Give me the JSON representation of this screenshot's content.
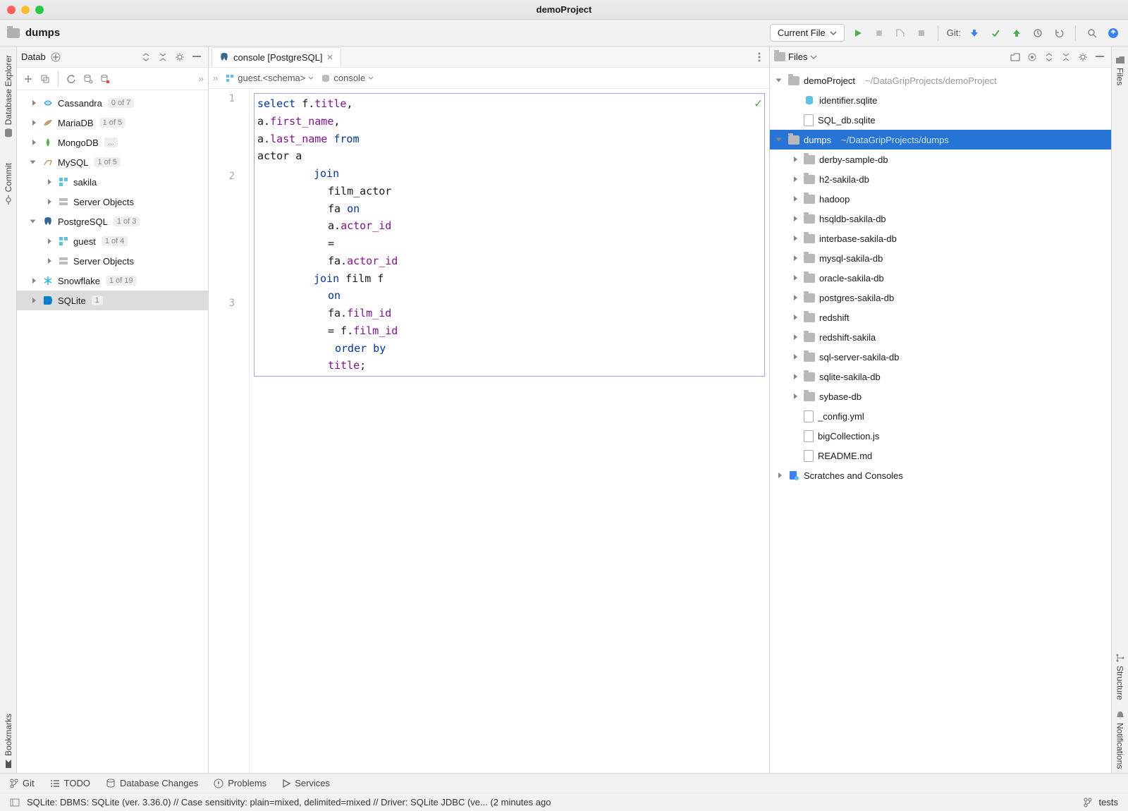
{
  "window_title": "demoProject",
  "breadcrumb_project": "dumps",
  "run_config": "Current File",
  "git_label": "Git:",
  "left_tools": {
    "db_explorer": "Database Explorer",
    "commit": "Commit",
    "bookmarks": "Bookmarks"
  },
  "right_tools": {
    "files": "Files",
    "structure": "Structure",
    "notifications": "Notifications"
  },
  "db_panel_title": "Datab",
  "db_tree": [
    {
      "name": "Cassandra",
      "badge": "0 of 7",
      "lvl": 1,
      "caret": "closed",
      "icon": "cassandra"
    },
    {
      "name": "MariaDB",
      "badge": "1 of 5",
      "lvl": 1,
      "caret": "closed",
      "icon": "mariadb"
    },
    {
      "name": "MongoDB",
      "badge": "...",
      "lvl": 1,
      "caret": "closed",
      "icon": "mongo"
    },
    {
      "name": "MySQL",
      "badge": "1 of 5",
      "lvl": 1,
      "caret": "open",
      "icon": "mysql"
    },
    {
      "name": "sakila",
      "badge": "",
      "lvl": 2,
      "caret": "closed",
      "icon": "schema"
    },
    {
      "name": "Server Objects",
      "badge": "",
      "lvl": 2,
      "caret": "closed",
      "icon": "server"
    },
    {
      "name": "PostgreSQL",
      "badge": "1 of 3",
      "lvl": 1,
      "caret": "open",
      "icon": "postgres"
    },
    {
      "name": "guest",
      "badge": "1 of 4",
      "lvl": 2,
      "caret": "closed",
      "icon": "schema"
    },
    {
      "name": "Server Objects",
      "badge": "",
      "lvl": 2,
      "caret": "closed",
      "icon": "server"
    },
    {
      "name": "Snowflake",
      "badge": "1 of 19",
      "lvl": 1,
      "caret": "closed",
      "icon": "snowflake"
    },
    {
      "name": "SQLite",
      "badge": "1",
      "lvl": 1,
      "caret": "closed",
      "icon": "sqlite",
      "selected": true
    }
  ],
  "editor_tab": "console [PostgreSQL]",
  "editor_crumb_schema": "guest.<schema>",
  "editor_crumb_console": "console",
  "code": {
    "l1": [
      {
        "t": "select ",
        "c": "kw"
      },
      {
        "t": "f",
        "c": "plain"
      },
      {
        "t": ".",
        "c": "plain"
      },
      {
        "t": "title",
        "c": "ident"
      },
      {
        "t": ", ",
        "c": "plain"
      }
    ],
    "l2": [
      {
        "t": "a",
        "c": "plain"
      },
      {
        "t": ".",
        "c": "plain"
      },
      {
        "t": "first_name",
        "c": "ident"
      },
      {
        "t": ", ",
        "c": "plain"
      }
    ],
    "l3": [
      {
        "t": "a",
        "c": "plain"
      },
      {
        "t": ".",
        "c": "plain"
      },
      {
        "t": "last_name",
        "c": "ident"
      },
      {
        "t": " from",
        "c": "kw"
      }
    ],
    "l4": [
      {
        "t": "actor ",
        "c": "plain"
      },
      {
        "t": "a",
        "c": "plain"
      }
    ],
    "l5": [
      {
        "t": "join",
        "c": "kw"
      }
    ],
    "l6": [
      {
        "t": "film_actor",
        "c": "plain"
      }
    ],
    "l7": [
      {
        "t": "fa ",
        "c": "plain"
      },
      {
        "t": "on",
        "c": "kw"
      }
    ],
    "l8": [
      {
        "t": "a.",
        "c": "plain"
      },
      {
        "t": "actor_id",
        "c": "ident"
      }
    ],
    "l9": [
      {
        "t": "=",
        "c": "plain"
      }
    ],
    "l10": [
      {
        "t": "fa.",
        "c": "plain"
      },
      {
        "t": "actor_id",
        "c": "ident"
      }
    ],
    "l11": [
      {
        "t": "join ",
        "c": "kw"
      },
      {
        "t": "film f",
        "c": "plain"
      }
    ],
    "l12": [
      {
        "t": "on",
        "c": "kw"
      }
    ],
    "l13": [
      {
        "t": "fa.",
        "c": "plain"
      },
      {
        "t": "film_id",
        "c": "ident"
      }
    ],
    "l14": [
      {
        "t": "= f.",
        "c": "plain"
      },
      {
        "t": "film_id",
        "c": "ident"
      }
    ],
    "l15": [
      {
        "t": "order by",
        "c": "kw"
      }
    ],
    "l16": [
      {
        "t": "title",
        "c": "ident"
      },
      {
        "t": ";",
        "c": "plain"
      }
    ]
  },
  "files_panel_title": "Files",
  "file_tree": [
    {
      "name": "demoProject",
      "hint": "~/DataGripProjects/demoProject",
      "lvl": 0,
      "caret": "open",
      "icon": "folder"
    },
    {
      "name": "identifier.sqlite",
      "lvl": 1,
      "icon": "db"
    },
    {
      "name": "SQL_db.sqlite",
      "lvl": 1,
      "icon": "file"
    },
    {
      "name": "dumps",
      "hint": "~/DataGripProjects/dumps",
      "lvl": 0,
      "caret": "open",
      "icon": "folder",
      "selected": true
    },
    {
      "name": "derby-sample-db",
      "lvl": 1,
      "caret": "closed",
      "icon": "folder"
    },
    {
      "name": "h2-sakila-db",
      "lvl": 1,
      "caret": "closed",
      "icon": "folder"
    },
    {
      "name": "hadoop",
      "lvl": 1,
      "caret": "closed",
      "icon": "folder"
    },
    {
      "name": "hsqldb-sakila-db",
      "lvl": 1,
      "caret": "closed",
      "icon": "folder"
    },
    {
      "name": "interbase-sakila-db",
      "lvl": 1,
      "caret": "closed",
      "icon": "folder"
    },
    {
      "name": "mysql-sakila-db",
      "lvl": 1,
      "caret": "closed",
      "icon": "folder"
    },
    {
      "name": "oracle-sakila-db",
      "lvl": 1,
      "caret": "closed",
      "icon": "folder"
    },
    {
      "name": "postgres-sakila-db",
      "lvl": 1,
      "caret": "closed",
      "icon": "folder"
    },
    {
      "name": "redshift",
      "lvl": 1,
      "caret": "closed",
      "icon": "folder"
    },
    {
      "name": "redshift-sakila",
      "lvl": 1,
      "caret": "closed",
      "icon": "folder"
    },
    {
      "name": "sql-server-sakila-db",
      "lvl": 1,
      "caret": "closed",
      "icon": "folder"
    },
    {
      "name": "sqlite-sakila-db",
      "lvl": 1,
      "caret": "closed",
      "icon": "folder"
    },
    {
      "name": "sybase-db",
      "lvl": 1,
      "caret": "closed",
      "icon": "folder"
    },
    {
      "name": "_config.yml",
      "lvl": 1,
      "icon": "file"
    },
    {
      "name": "bigCollection.js",
      "lvl": 1,
      "icon": "file"
    },
    {
      "name": "README.md",
      "lvl": 1,
      "icon": "file"
    },
    {
      "name": "Scratches and Consoles",
      "lvl": 0,
      "caret": "closed",
      "icon": "scratch"
    }
  ],
  "bottom_tabs": {
    "git": "Git",
    "todo": "TODO",
    "db_changes": "Database Changes",
    "problems": "Problems",
    "services": "Services"
  },
  "status_message": "SQLite: DBMS: SQLite (ver. 3.36.0) // Case sensitivity: plain=mixed, delimited=mixed // Driver: SQLite JDBC (ve... (2 minutes ago",
  "status_branch": "tests"
}
